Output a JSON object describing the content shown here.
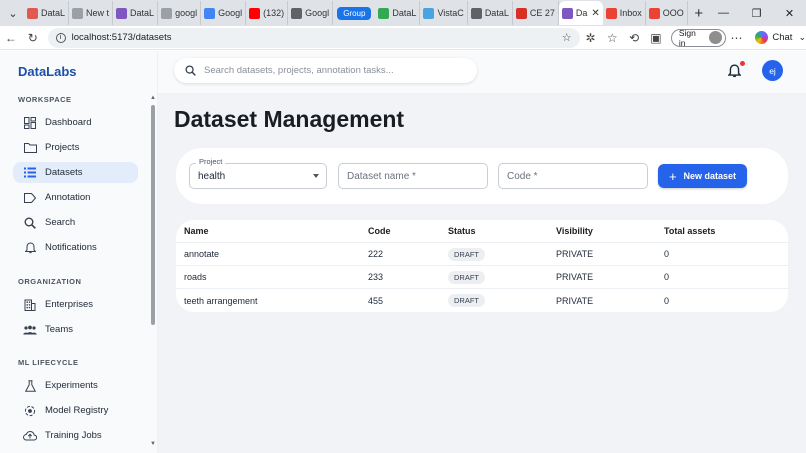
{
  "browser": {
    "tabs": [
      {
        "label": "DataL",
        "color": "#e05a4f"
      },
      {
        "label": "New t",
        "color": "#9aa0a6"
      },
      {
        "label": "DataL",
        "color": "#7e57c2"
      },
      {
        "label": "googl",
        "color": "#9aa0a6"
      },
      {
        "label": "Googl",
        "color": "#4285f4"
      },
      {
        "label": "(132)",
        "color": "#ff0000"
      },
      {
        "label": "Googl",
        "color": "#5f6368"
      }
    ],
    "group_label": "Group",
    "tabs_after_group": [
      {
        "label": "DataL",
        "color": "#34a853"
      },
      {
        "label": "VistaC",
        "color": "#4aa3df"
      },
      {
        "label": "DataL",
        "color": "#5f6368"
      },
      {
        "label": "CE 27",
        "color": "#d93025"
      }
    ],
    "active_tab": {
      "label": "Da",
      "color": "#7e57c2"
    },
    "tabs_right": [
      {
        "label": "Inbox",
        "color": "#ea4335"
      },
      {
        "label": "OOO",
        "color": "#ea4335"
      }
    ],
    "url": "localhost:5173/datasets",
    "signin_label": "Sign in",
    "chat_label": "Chat"
  },
  "app": {
    "brand": "DataLabs",
    "search_placeholder": "Search datasets, projects, annotation tasks...",
    "avatar_initials": "ej",
    "accent_color": "#2563eb"
  },
  "sidebar": {
    "sections": [
      {
        "label": "WORKSPACE",
        "items": [
          {
            "label": "Dashboard",
            "icon": "dashboard-icon"
          },
          {
            "label": "Projects",
            "icon": "folder-icon"
          },
          {
            "label": "Datasets",
            "icon": "list-icon",
            "active": true
          },
          {
            "label": "Annotation",
            "icon": "label-icon"
          },
          {
            "label": "Search",
            "icon": "search-icon"
          },
          {
            "label": "Notifications",
            "icon": "bell-icon"
          }
        ]
      },
      {
        "label": "ORGANIZATION",
        "items": [
          {
            "label": "Enterprises",
            "icon": "building-icon"
          },
          {
            "label": "Teams",
            "icon": "people-icon"
          }
        ]
      },
      {
        "label": "ML LIFECYCLE",
        "items": [
          {
            "label": "Experiments",
            "icon": "flask-icon"
          },
          {
            "label": "Model Registry",
            "icon": "registry-icon"
          },
          {
            "label": "Training Jobs",
            "icon": "cloud-upload-icon"
          }
        ]
      }
    ]
  },
  "page": {
    "title": "Dataset Management",
    "form": {
      "project_label": "Project",
      "project_value": "health",
      "dataset_name_placeholder": "Dataset name *",
      "code_placeholder": "Code *",
      "new_button_label": "New dataset"
    },
    "table": {
      "columns": [
        "Name",
        "Code",
        "Status",
        "Visibility",
        "Total assets"
      ],
      "rows": [
        {
          "name": "annotate",
          "code": "222",
          "status": "DRAFT",
          "visibility": "PRIVATE",
          "total_assets": "0"
        },
        {
          "name": "roads",
          "code": "233",
          "status": "DRAFT",
          "visibility": "PRIVATE",
          "total_assets": "0"
        },
        {
          "name": "teeth arrangement",
          "code": "455",
          "status": "DRAFT",
          "visibility": "PRIVATE",
          "total_assets": "0"
        }
      ]
    }
  }
}
